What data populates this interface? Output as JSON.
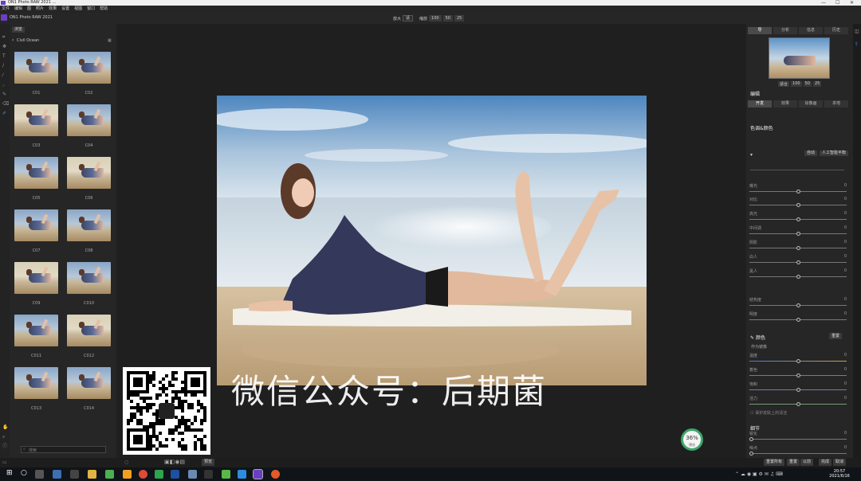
{
  "title_bar": {
    "text": "ON1 Photo RAW 2021 ...",
    "minimize": "—",
    "maximize": "☐",
    "close": "✕"
  },
  "menu": [
    "文件",
    "编辑",
    "图",
    "照片",
    "效果",
    "设置",
    "视图",
    "窗口",
    "帮助"
  ],
  "toolbar": {
    "zoom_label": "放大",
    "zoom_value": "适",
    "scale_label": "缩放",
    "scale_options": [
      "100",
      "50",
      "25"
    ]
  },
  "library": {
    "app_name": "ON1 Photo RAW 2021",
    "browse_button": "浏览",
    "folder": "Civil Ocean",
    "thumbnails": [
      "C01",
      "C02",
      "C03",
      "C04",
      "C05",
      "C06",
      "C07",
      "C08",
      "C09",
      "C010",
      "C011",
      "C012",
      "C013",
      "C014"
    ],
    "search_placeholder": "搜索"
  },
  "watermark": "微信公众号：后期菌",
  "right_panel": {
    "top_tabs": [
      "导",
      "分析",
      "信息",
      "历史"
    ],
    "nav_scale": [
      "适合",
      "100",
      "50",
      "25"
    ],
    "mode_label": "编辑",
    "edit_tabs": [
      "开发",
      "效果",
      "肖像画",
      "本地"
    ],
    "section_title": "色调&颜色",
    "auto_buttons": [
      "自动",
      "人工智能平衡"
    ],
    "sliders": [
      {
        "label": "曝光",
        "value": "0",
        "pos": 0.5
      },
      {
        "label": "对比",
        "value": "0",
        "pos": 0.5
      },
      {
        "label": "高光",
        "value": "0",
        "pos": 0.5
      },
      {
        "label": "中间调",
        "value": "0",
        "pos": 0.5
      },
      {
        "label": "阴影",
        "value": "0",
        "pos": 0.5
      },
      {
        "label": "白人",
        "value": "0",
        "pos": 0.5
      },
      {
        "label": "黑人",
        "value": "0",
        "pos": 0.5
      },
      {
        "label": "结构度",
        "value": "0",
        "pos": 0.5
      },
      {
        "label": "明度",
        "value": "0",
        "pos": 0.5
      }
    ],
    "color_section": "颜色",
    "color_button": "重置",
    "color_mode": "作为镜像",
    "color_sliders": [
      {
        "label": "温度",
        "value": "0",
        "pos": 0.5
      },
      {
        "label": "着色",
        "value": "0",
        "pos": 0.5
      },
      {
        "label": "饱和",
        "value": "0",
        "pos": 0.5
      },
      {
        "label": "活力",
        "value": "0",
        "pos": 0.5
      }
    ],
    "checkbox_label": "保护皮肤上的清洁",
    "detail_section": "细节",
    "detail_sliders": [
      {
        "label": "锐化",
        "value": "0",
        "pos": 0.0
      },
      {
        "label": "噪点",
        "value": "0",
        "pos": 0.0
      }
    ]
  },
  "zoom_badge": {
    "percent": "36%",
    "sub": "预览"
  },
  "status_bar": {
    "preview_button": "预览",
    "bottom_buttons": [
      "重置所有",
      "重置",
      "以前",
      "完成",
      "取消"
    ]
  },
  "taskbar": {
    "time": "20:57",
    "date": "2021/6/16"
  },
  "colors": {
    "accent": "#6b3fc4",
    "panel": "#262626",
    "canvas": "#1f1f1f",
    "badge": "#3ea66a"
  }
}
